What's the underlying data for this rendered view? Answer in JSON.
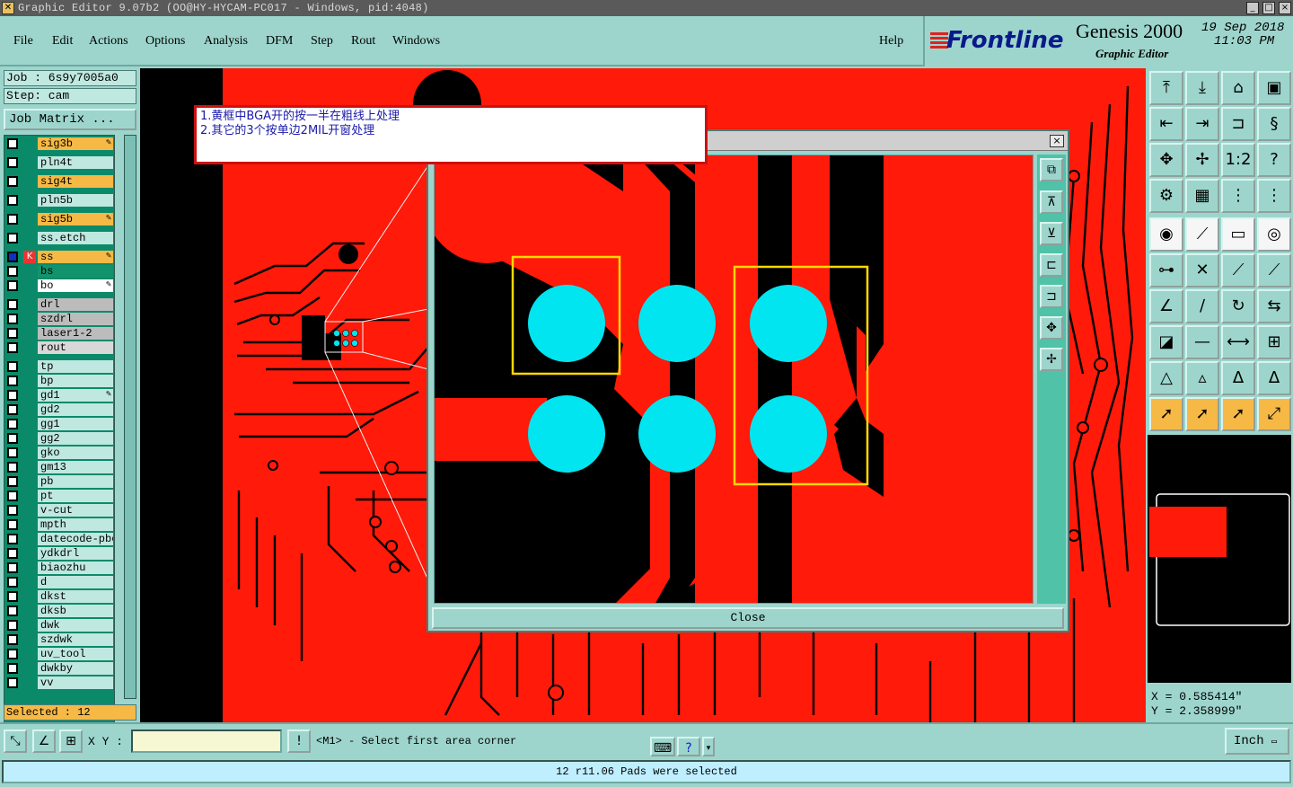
{
  "window": {
    "title": "Graphic Editor 9.07b2 (OO@HY-HYCAM-PC017 - Windows, pid:4048)",
    "controls": [
      "_",
      "□",
      "×"
    ]
  },
  "menu": [
    {
      "label": "File"
    },
    {
      "label": "Edit"
    },
    {
      "label": "Actions"
    },
    {
      "label": "Options"
    },
    {
      "label": "Analysis"
    },
    {
      "label": "DFM"
    },
    {
      "label": "Step"
    },
    {
      "label": "Rout"
    },
    {
      "label": "Windows"
    },
    {
      "label": "Help"
    }
  ],
  "brand": {
    "logo": "Frontline",
    "product": "Genesis 2000",
    "subtitle": "Graphic Editor",
    "date": "19 Sep 2018",
    "time": "11:03 PM"
  },
  "job": {
    "job_line": "Job : 6s9y7005a0",
    "step_line": "Step: cam",
    "matrix_button": "Job Matrix ..."
  },
  "layers": [
    {
      "name": "sig3b",
      "kind": "sig",
      "mark": "✎"
    },
    {
      "name": "pln4t",
      "kind": "plain",
      "mark": ""
    },
    {
      "name": "sig4t",
      "kind": "sig",
      "mark": ""
    },
    {
      "name": "pln5b",
      "kind": "plain",
      "mark": ""
    },
    {
      "name": "sig5b",
      "kind": "sig",
      "mark": "✎"
    },
    {
      "name": "ss.etch",
      "kind": "plain",
      "mark": ""
    },
    {
      "name": "ss",
      "kind": "sig",
      "mark": "✎"
    },
    {
      "name": "bs",
      "kind": "bs",
      "mark": ""
    },
    {
      "name": "bo",
      "kind": "bo",
      "mark": "✎"
    },
    {
      "name": "drl",
      "kind": "drl",
      "mark": ""
    },
    {
      "name": "szdrl",
      "kind": "drl",
      "mark": ""
    },
    {
      "name": "laser1-2",
      "kind": "drl",
      "mark": ""
    },
    {
      "name": "rout",
      "kind": "rout",
      "mark": ""
    },
    {
      "name": "tp",
      "kind": "plain",
      "mark": ""
    },
    {
      "name": "bp",
      "kind": "plain",
      "mark": ""
    },
    {
      "name": "gd1",
      "kind": "plain",
      "mark": "✎"
    },
    {
      "name": "gd2",
      "kind": "plain",
      "mark": ""
    },
    {
      "name": "gg1",
      "kind": "plain",
      "mark": ""
    },
    {
      "name": "gg2",
      "kind": "plain",
      "mark": ""
    },
    {
      "name": "gko",
      "kind": "plain",
      "mark": ""
    },
    {
      "name": "gm13",
      "kind": "plain",
      "mark": ""
    },
    {
      "name": "pb",
      "kind": "plain",
      "mark": ""
    },
    {
      "name": "pt",
      "kind": "plain",
      "mark": ""
    },
    {
      "name": "v-cut",
      "kind": "plain",
      "mark": ""
    },
    {
      "name": "mpth",
      "kind": "plain",
      "mark": ""
    },
    {
      "name": "datecode-pbe",
      "kind": "plain",
      "mark": ""
    },
    {
      "name": "ydkdrl",
      "kind": "plain",
      "mark": ""
    },
    {
      "name": "biaozhu",
      "kind": "plain",
      "mark": ""
    },
    {
      "name": "d",
      "kind": "plain",
      "mark": ""
    },
    {
      "name": "dkst",
      "kind": "plain",
      "mark": ""
    },
    {
      "name": "dksb",
      "kind": "plain",
      "mark": ""
    },
    {
      "name": "dwk",
      "kind": "plain",
      "mark": ""
    },
    {
      "name": "szdwk",
      "kind": "plain",
      "mark": ""
    },
    {
      "name": "uv_tool",
      "kind": "plain",
      "mark": ""
    },
    {
      "name": "dwkby",
      "kind": "plain",
      "mark": ""
    },
    {
      "name": "vv",
      "kind": "plain",
      "mark": ""
    }
  ],
  "selected": "Selected : 12",
  "note": {
    "line1": "1.黄框中BGA开的按一半在粗线上处理",
    "line2": "2.其它的3个按单边2MIL开窗处理"
  },
  "zoom_dialog": {
    "close_label": "Close",
    "close_icon": "×"
  },
  "coords": {
    "x": "X = 0.585414\"",
    "y": "Y = 2.358999\""
  },
  "bottom": {
    "xy_label": "X Y :",
    "xy_value": "",
    "prompt": "<M1> - Select first area corner",
    "units": "Inch",
    "status": "12 r11.06 Pads were selected"
  },
  "colors": {
    "copper": "#ff1a0a",
    "pad": "#00e5f0",
    "highlight": "#ffd800",
    "panel": "#9dd5cc"
  }
}
